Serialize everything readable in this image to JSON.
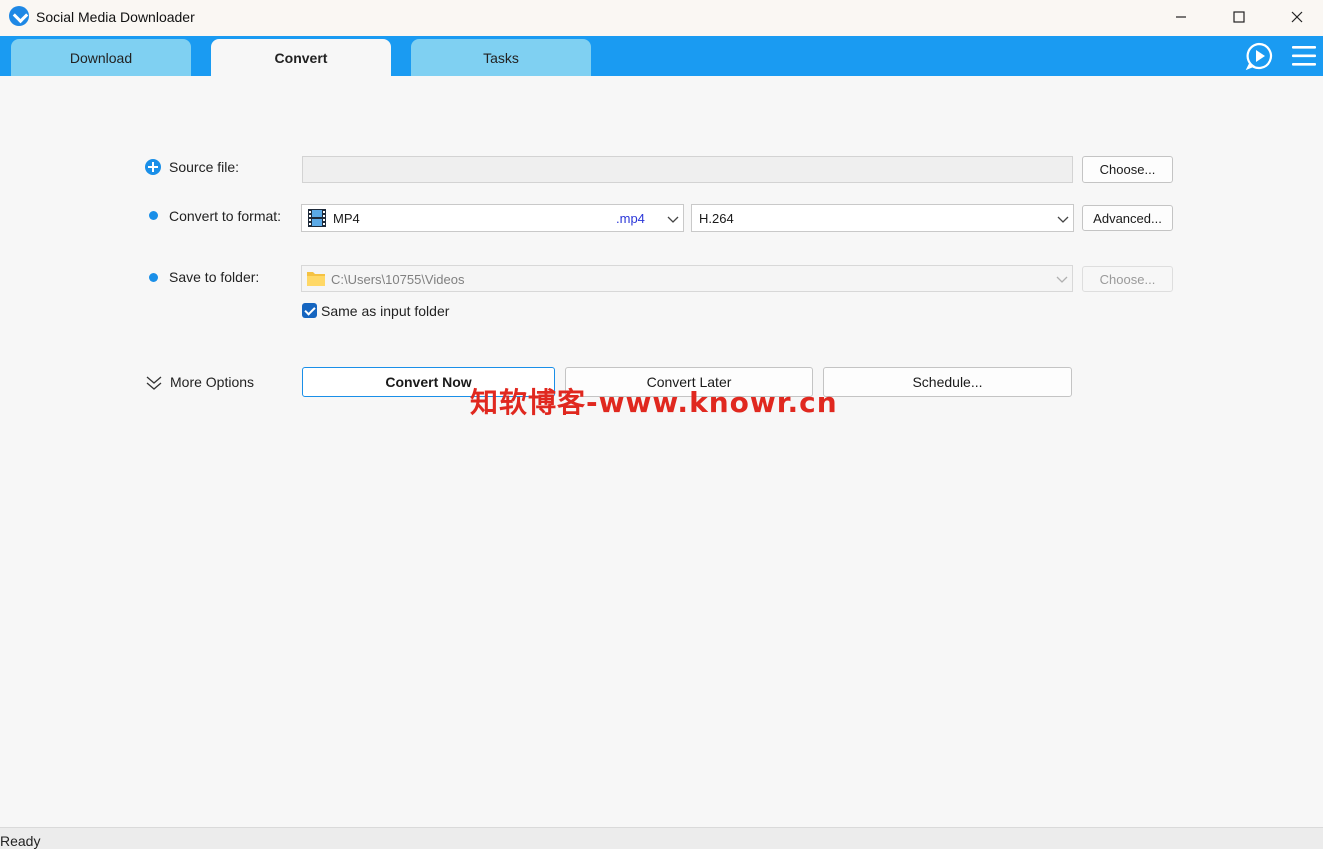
{
  "window": {
    "title": "Social Media Downloader",
    "minimize_icon": "minimize-icon",
    "maximize_icon": "maximize-icon",
    "close_icon": "close-icon"
  },
  "tabs": [
    {
      "label": "Download",
      "active": false
    },
    {
      "label": "Convert",
      "active": true
    },
    {
      "label": "Tasks",
      "active": false
    }
  ],
  "header_icons": [
    "play-chat-icon",
    "hamburger-menu-icon"
  ],
  "colors": {
    "accent": "#1a9bf2",
    "tab_inactive": "#7fd0f2",
    "checkbox": "#1565c0",
    "extension_text": "#2a36d8",
    "watermark": "#e0281f"
  },
  "form": {
    "source_file": {
      "label": "Source file:",
      "value": "",
      "choose_label": "Choose..."
    },
    "convert_format": {
      "label": "Convert to format:",
      "format_name": "MP4",
      "format_ext": ".mp4",
      "codec": "H.264",
      "advanced_label": "Advanced..."
    },
    "save_folder": {
      "label": "Save to folder:",
      "path": "C:\\Users\\10755\\Videos",
      "choose_label": "Choose...",
      "same_as_input_label": "Same as input folder",
      "same_as_input_checked": true
    }
  },
  "actions": {
    "more_options_label": "More Options",
    "convert_now_label": "Convert Now",
    "convert_later_label": "Convert Later",
    "schedule_label": "Schedule..."
  },
  "watermark": "知软博客-www.knowr.cn",
  "status": {
    "text": "Ready"
  }
}
